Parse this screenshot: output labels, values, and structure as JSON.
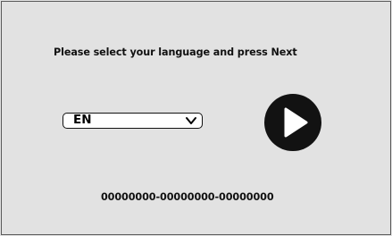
{
  "prompt": {
    "text": "Please select your language and press Next"
  },
  "language_select": {
    "selected": "EN",
    "icon": "chevron-down-icon"
  },
  "next_button": {
    "icon": "play-icon"
  },
  "serial": {
    "text": "00000000-00000000-00000000"
  },
  "colors": {
    "background": "#e2e2e2",
    "button": "#121212",
    "text": "#111111"
  }
}
